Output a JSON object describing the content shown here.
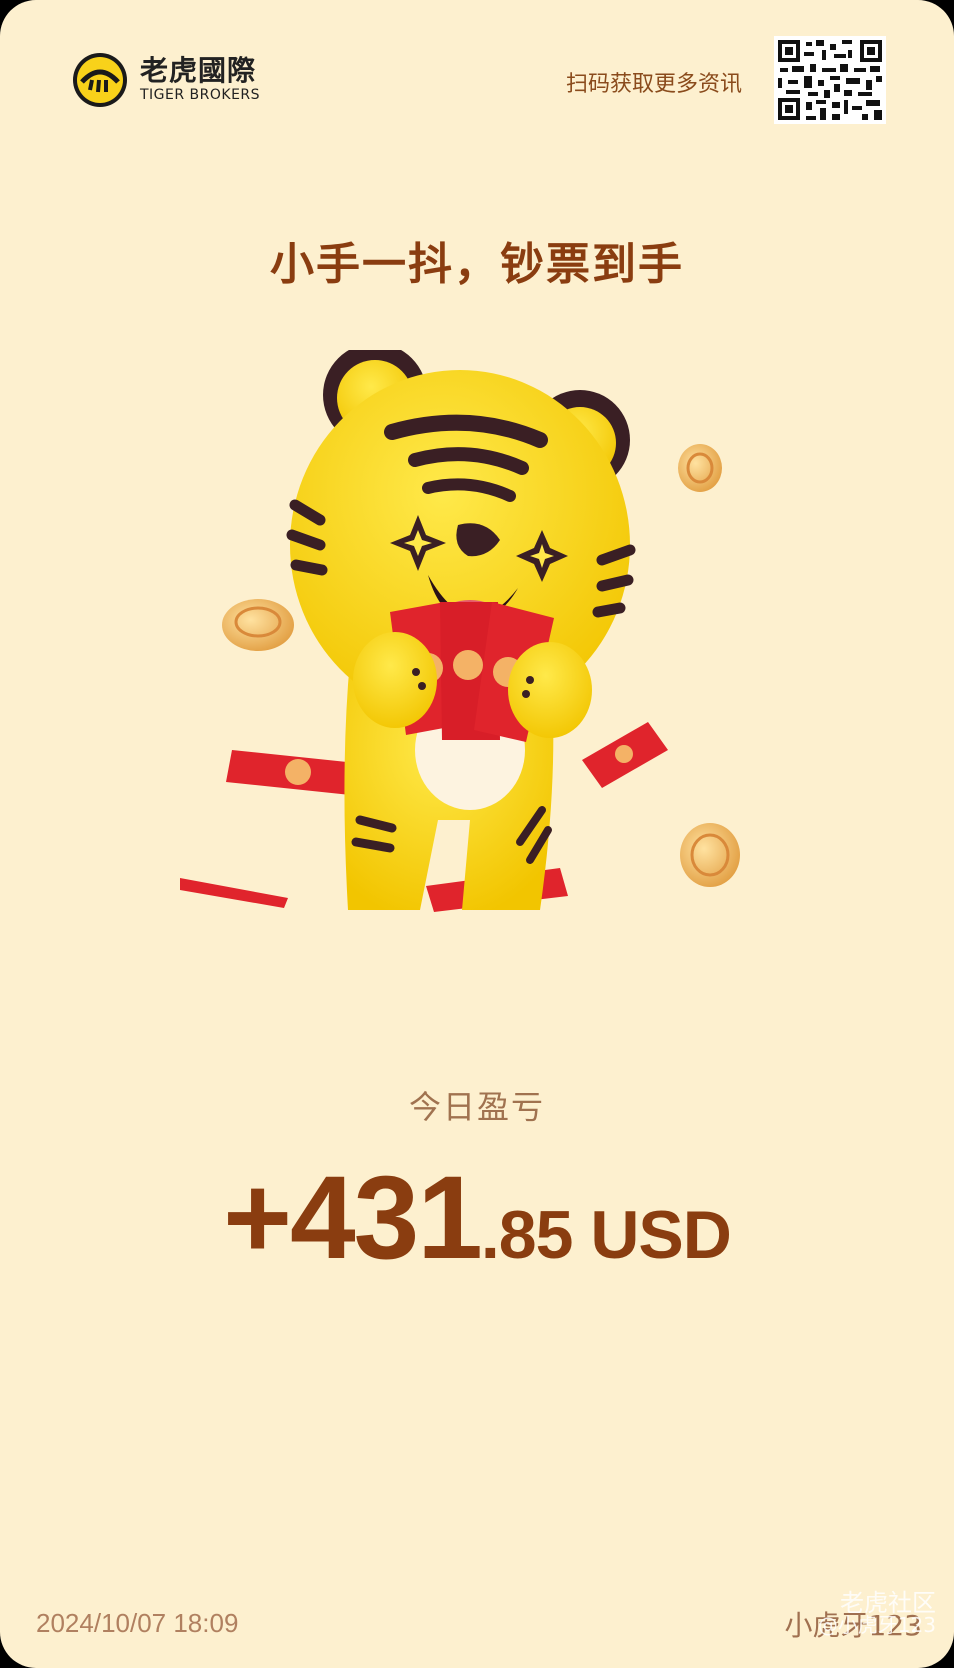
{
  "brand": {
    "name_cn": "老虎國際",
    "name_en": "TIGER BROKERS"
  },
  "header": {
    "scan_text": "扫码获取更多资讯"
  },
  "slogan": "小手一抖，钞票到手",
  "pnl": {
    "label": "今日盈亏",
    "integer_part": "+431",
    "decimal_part": ".85",
    "currency": "USD"
  },
  "footer": {
    "datetime": "2024/10/07 18:09",
    "username": "小虎牙123"
  },
  "watermark": {
    "community": "老虎社区",
    "handle": "@小虎牙123"
  },
  "colors": {
    "background": "#fdf0cf",
    "accent": "#8a3d10",
    "tiger": "#f8d21a",
    "envelope": "#e0242c"
  }
}
